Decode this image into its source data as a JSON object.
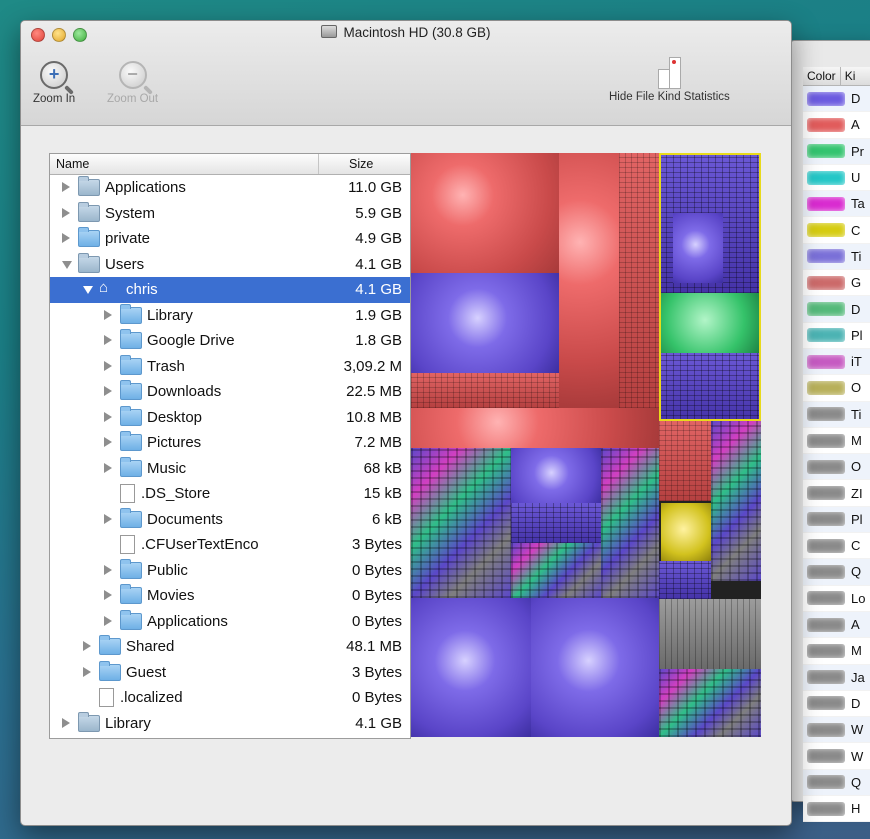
{
  "window": {
    "title": "Macintosh HD (30.8 GB)"
  },
  "toolbar": {
    "zoom_in": "Zoom In",
    "zoom_out": "Zoom Out",
    "hide_stats": "Hide File Kind Statistics"
  },
  "outline": {
    "col_name": "Name",
    "col_size": "Size",
    "rows": [
      {
        "name": "Applications",
        "size": "11.0 GB"
      },
      {
        "name": "System",
        "size": "5.9 GB"
      },
      {
        "name": "private",
        "size": "4.9 GB"
      },
      {
        "name": "Users",
        "size": "4.1 GB"
      },
      {
        "name": "chris",
        "size": "4.1 GB"
      },
      {
        "name": "Library",
        "size": "1.9 GB"
      },
      {
        "name": "Google Drive",
        "size": "1.8 GB"
      },
      {
        "name": "Trash",
        "size": "3,09.2 M"
      },
      {
        "name": "Downloads",
        "size": "22.5 MB"
      },
      {
        "name": "Desktop",
        "size": "10.8 MB"
      },
      {
        "name": "Pictures",
        "size": "7.2 MB"
      },
      {
        "name": "Music",
        "size": "68 kB"
      },
      {
        "name": ".DS_Store",
        "size": "15 kB"
      },
      {
        "name": "Documents",
        "size": "6 kB"
      },
      {
        "name": ".CFUserTextEnco",
        "size": "3 Bytes"
      },
      {
        "name": "Public",
        "size": "0 Bytes"
      },
      {
        "name": "Movies",
        "size": "0 Bytes"
      },
      {
        "name": "Applications",
        "size": "0 Bytes"
      },
      {
        "name": "Shared",
        "size": "48.1 MB"
      },
      {
        "name": "Guest",
        "size": "3 Bytes"
      },
      {
        "name": ".localized",
        "size": "0 Bytes"
      },
      {
        "name": "Library",
        "size": "4.1 GB"
      }
    ]
  },
  "kinds_panel": {
    "col_color": "Color",
    "col_kind": "Ki",
    "items": [
      {
        "label": "D",
        "color": "#6b5ae0"
      },
      {
        "label": "A",
        "color": "#e15b5b"
      },
      {
        "label": "Pr",
        "color": "#33c46f"
      },
      {
        "label": "U",
        "color": "#23c7c7"
      },
      {
        "label": "Ta",
        "color": "#d92bd0"
      },
      {
        "label": "C",
        "color": "#d6cc10"
      },
      {
        "label": "Ti",
        "color": "#7a70d8"
      },
      {
        "label": "G",
        "color": "#cc6a6a"
      },
      {
        "label": "D",
        "color": "#54b97a"
      },
      {
        "label": "Pl",
        "color": "#4bb3b3"
      },
      {
        "label": "iT",
        "color": "#c65ac2"
      },
      {
        "label": "O",
        "color": "#b8b05a"
      },
      {
        "label": "Ti",
        "color": "#8a8a8a"
      },
      {
        "label": "M",
        "color": "#8a8a8a"
      },
      {
        "label": "O",
        "color": "#8a8a8a"
      },
      {
        "label": "ZI",
        "color": "#8a8a8a"
      },
      {
        "label": "Pl",
        "color": "#8a8a8a"
      },
      {
        "label": "C",
        "color": "#8a8a8a"
      },
      {
        "label": "Q",
        "color": "#8a8a8a"
      },
      {
        "label": "Lo",
        "color": "#8a8a8a"
      },
      {
        "label": "A",
        "color": "#8a8a8a"
      },
      {
        "label": "M",
        "color": "#8a8a8a"
      },
      {
        "label": "Ja",
        "color": "#8a8a8a"
      },
      {
        "label": "D",
        "color": "#8a8a8a"
      },
      {
        "label": "W",
        "color": "#8a8a8a"
      },
      {
        "label": "W",
        "color": "#8a8a8a"
      },
      {
        "label": "Q",
        "color": "#8a8a8a"
      },
      {
        "label": "H",
        "color": "#8a8a8a"
      }
    ]
  }
}
